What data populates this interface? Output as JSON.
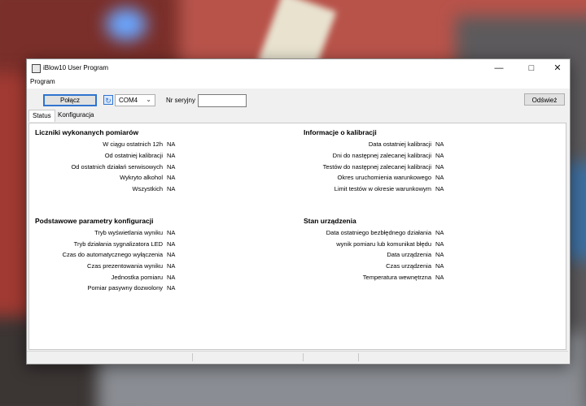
{
  "window": {
    "title": "iBlow10 User Program"
  },
  "menu": {
    "program": "Program"
  },
  "toolbar": {
    "connect_label": "Połącz",
    "port_value": "COM4",
    "serial_label": "Nr seryjny",
    "serial_value": "",
    "refresh_label": "Odśwież"
  },
  "tabs": {
    "status": "Status",
    "config": "Konfiguracja"
  },
  "counters": {
    "title": "Liczniki wykonanych pomiarów",
    "rows": [
      {
        "label": "W ciągu ostatnich 12h",
        "value": "NA"
      },
      {
        "label": "Od ostatniej kalibracji",
        "value": "NA"
      },
      {
        "label": "Od ostatnich działań serwisowych",
        "value": "NA"
      },
      {
        "label": "Wykryto alkohol",
        "value": "NA"
      },
      {
        "label": "Wszystkich",
        "value": "NA"
      }
    ]
  },
  "calibration": {
    "title": "Informacje o kalibracji",
    "rows": [
      {
        "label": "Data ostatniej kalibracji",
        "value": "NA"
      },
      {
        "label": "Dni do następnej zalecanej kalibracji",
        "value": "NA"
      },
      {
        "label": "Testów do następnej zalecanej kalibracji",
        "value": "NA"
      },
      {
        "label": "Okres uruchomienia warunkowego",
        "value": "NA"
      },
      {
        "label": "Limit testów w okresie warunkowym",
        "value": "NA"
      }
    ]
  },
  "basic_config": {
    "title": "Podstawowe parametry konfiguracji",
    "rows": [
      {
        "label": "Tryb wyświetlania wyniku",
        "value": "NA"
      },
      {
        "label": "Tryb działania sygnalizatora LED",
        "value": "NA"
      },
      {
        "label": "Czas do automatycznego wyłączenia",
        "value": "NA"
      },
      {
        "label": "Czas prezentowania wyniku",
        "value": "NA"
      },
      {
        "label": "Jednostka pomiaru",
        "value": "NA"
      },
      {
        "label": "Pomiar pasywny dozwolony",
        "value": "NA"
      }
    ]
  },
  "device_state": {
    "title": "Stan urządzenia",
    "rows": [
      {
        "label": "Data ostatniego bezbłędnego działania",
        "value": "NA"
      },
      {
        "label": "wynik pomiaru lub komunikat błędu",
        "value": "NA"
      },
      {
        "label": "Data urządzenia",
        "value": "NA"
      },
      {
        "label": "Czas urządzenia",
        "value": "NA"
      },
      {
        "label": "Temperatura wewnętrzna",
        "value": "NA"
      }
    ]
  }
}
